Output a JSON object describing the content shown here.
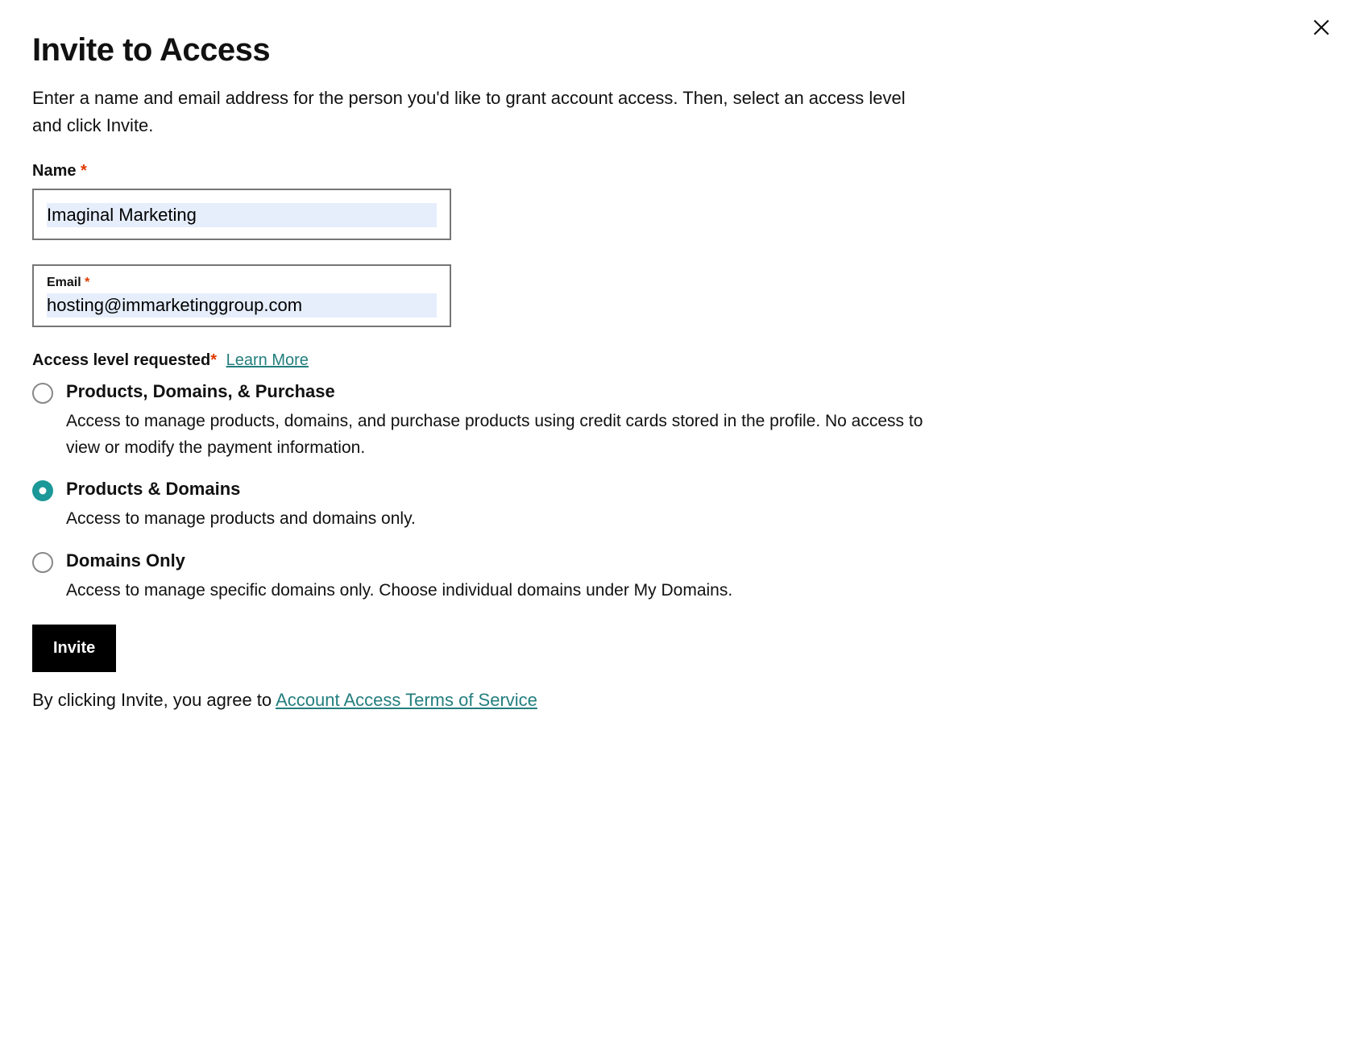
{
  "header": {
    "title": "Invite to Access",
    "intro": "Enter a name and email address for the person you'd like to grant account access. Then, select an access level and click Invite."
  },
  "form": {
    "name": {
      "label": "Name",
      "value": "Imaginal Marketing"
    },
    "email": {
      "label": "Email",
      "value": "hosting@immarketinggroup.com"
    },
    "access_level": {
      "label": "Access level requested",
      "learn_more": "Learn More",
      "options": [
        {
          "title": "Products, Domains, & Purchase",
          "desc": "Access to manage products, domains, and purchase products using credit cards stored in the profile. No access to view or modify the payment information.",
          "selected": false
        },
        {
          "title": "Products & Domains",
          "desc": "Access to manage products and domains only.",
          "selected": true
        },
        {
          "title": "Domains Only",
          "desc": "Access to manage specific domains only. Choose individual domains under My Domains.",
          "selected": false
        }
      ]
    },
    "submit_label": "Invite",
    "agreement_prefix": "By clicking Invite, you agree to ",
    "agreement_link": "Account Access Terms of Service"
  }
}
